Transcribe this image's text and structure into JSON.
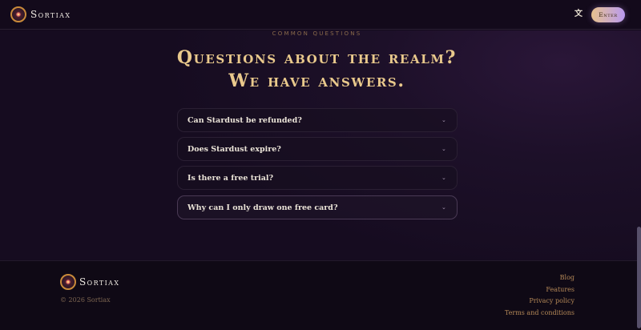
{
  "header": {
    "brand": "Sortiax",
    "translate_icon": "translate-icon",
    "enter_label": "Enter"
  },
  "faq": {
    "eyebrow": "COMMON QUESTIONS",
    "headline_line1": "Questions about the realm?",
    "headline_line2": "We have answers.",
    "items": [
      {
        "question": "Can Stardust be refunded?"
      },
      {
        "question": "Does Stardust expire?"
      },
      {
        "question": "Is there a free trial?"
      },
      {
        "question": "Why can I only draw one free card?"
      }
    ]
  },
  "footer": {
    "brand": "Sortiax",
    "copyright": "© 2026 Sortiax",
    "links": [
      "Blog",
      "Features",
      "Privacy policy",
      "Terms and conditions"
    ]
  },
  "colors": {
    "accent_gold": "#e9c98c",
    "link_gold": "#b48857",
    "background": "#140b1c"
  }
}
